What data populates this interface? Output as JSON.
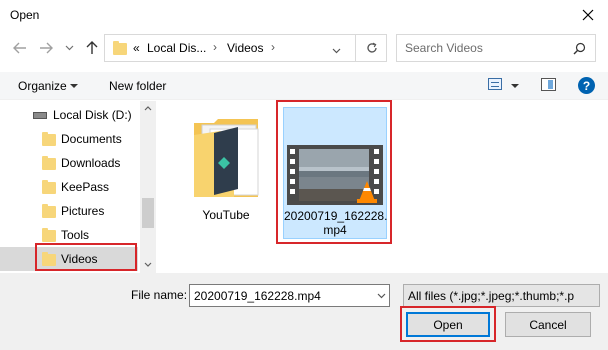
{
  "window": {
    "title": "Open"
  },
  "address": {
    "overflow": "«",
    "crumbs": [
      "Local Dis...",
      "Videos"
    ]
  },
  "search": {
    "placeholder": "Search Videos"
  },
  "toolbar": {
    "organize": "Organize",
    "new_folder": "New folder"
  },
  "nav": {
    "drive": "Local Disk (D:)",
    "items": [
      {
        "label": "Documents"
      },
      {
        "label": "Downloads"
      },
      {
        "label": "KeePass"
      },
      {
        "label": "Pictures"
      },
      {
        "label": "Tools"
      },
      {
        "label": "Videos",
        "selected": true
      }
    ]
  },
  "files": [
    {
      "name": "YouTube",
      "type": "folder"
    },
    {
      "name": "20200719_162228.mp4",
      "type": "video",
      "selected": true
    }
  ],
  "bottom": {
    "filename_label": "File name:",
    "filename_value": "20200719_162228.mp4",
    "filter_value": "All files (*.jpg;*.jpeg;*.thumb;*.p",
    "open_label": "Open",
    "cancel_label": "Cancel"
  },
  "colors": {
    "highlight_red": "#d7262a",
    "selection": "#cce8ff",
    "accent_blue": "#0063b1"
  }
}
